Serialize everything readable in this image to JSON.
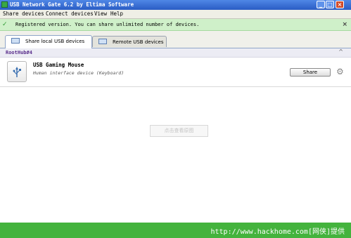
{
  "window": {
    "title": "USB Network Gate 6.2 by Eltima Software"
  },
  "menu": [
    "Share devices",
    "Connect devices",
    "View",
    "Help"
  ],
  "notice": {
    "text": "Registered version. You can share unlimited number of devices."
  },
  "tabs": [
    {
      "label": "Share local USB devices",
      "active": true
    },
    {
      "label": "Remote USB devices",
      "active": false
    }
  ],
  "group": {
    "title": "RootHub#4"
  },
  "device": {
    "name": "USB Gaming Mouse",
    "description": "Human interface device (Keyboard)",
    "share_label": "Share"
  },
  "hint": {
    "text": "点击查看原图"
  },
  "footer": {
    "text": "http://www.hackhome.com[网侠]提供"
  }
}
